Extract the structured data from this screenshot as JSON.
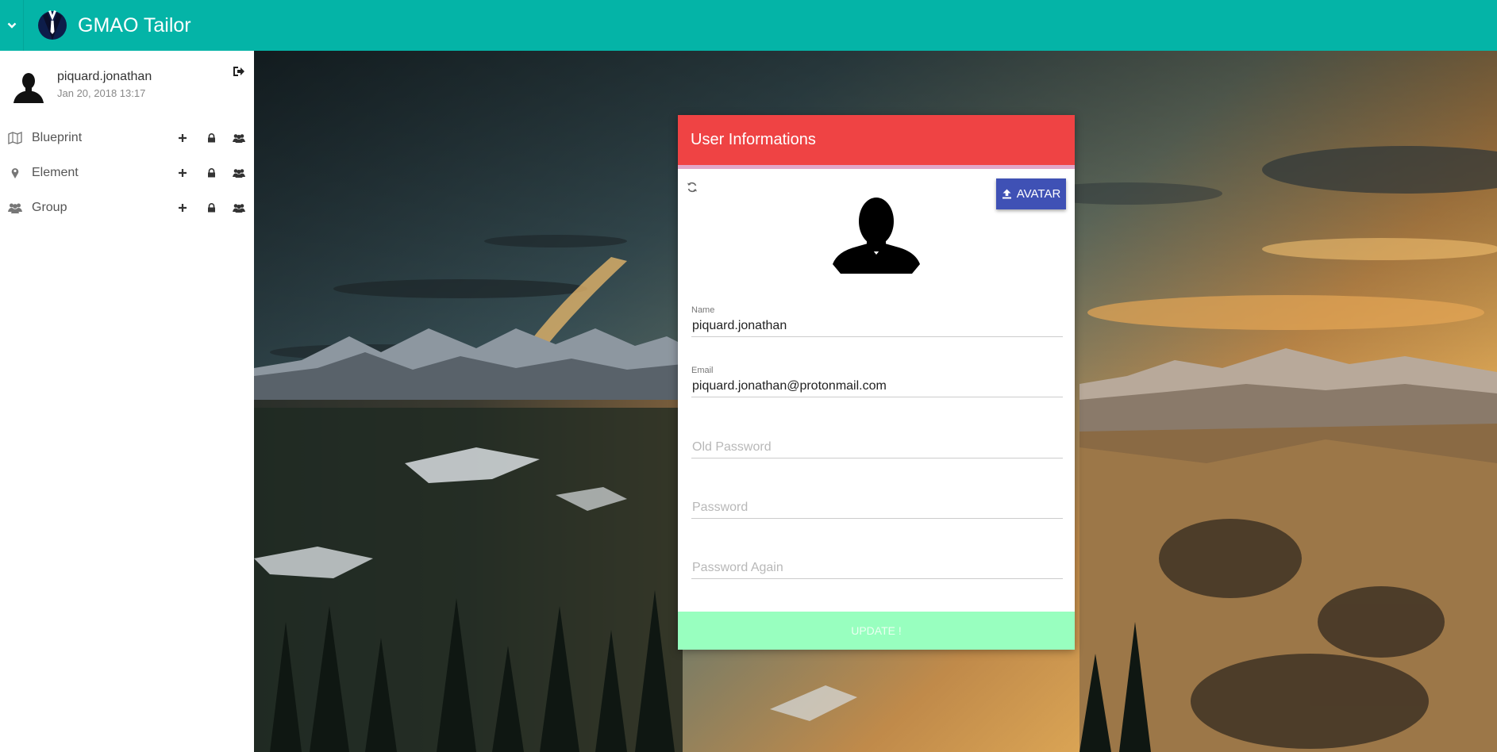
{
  "app": {
    "title": "GMAO Tailor"
  },
  "user": {
    "name": "piquard.jonathan",
    "last_login": "Jan 20, 2018 13:17"
  },
  "sidebar": {
    "items": [
      {
        "label": "Blueprint",
        "icon": "map-icon"
      },
      {
        "label": "Element",
        "icon": "map-marker-icon"
      },
      {
        "label": "Group",
        "icon": "users-icon"
      }
    ],
    "actions": [
      "plus-icon",
      "lock-icon",
      "users-icon"
    ]
  },
  "card": {
    "title": "User Informations",
    "avatar_button": "AVATAR",
    "fields": {
      "name": {
        "label": "Name",
        "value": "piquard.jonathan"
      },
      "email": {
        "label": "Email",
        "value": "piquard.jonathan@protonmail.com"
      },
      "old_password": {
        "placeholder": "Old Password"
      },
      "password": {
        "placeholder": "Password"
      },
      "password_again": {
        "placeholder": "Password Again"
      }
    },
    "update_button": "UPDATE !"
  },
  "colors": {
    "topbar": "#04b4a7",
    "card_header": "#ef4344",
    "avatar_button": "#3f51b5",
    "update_button": "#98ffbf"
  }
}
